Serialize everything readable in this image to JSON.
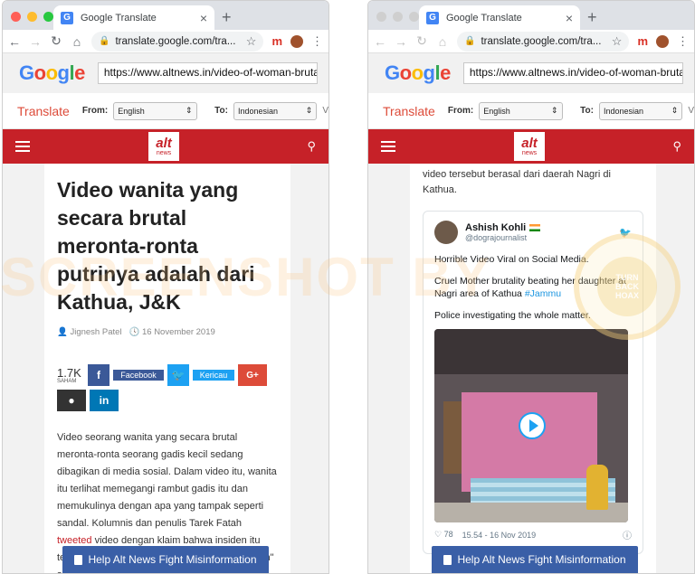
{
  "browser": {
    "tab_title": "Google Translate",
    "tab_close": "×",
    "new_tab": "+",
    "address": "translate.google.com/tra...",
    "menu_ext": "m"
  },
  "translate_bar": {
    "logo_letters": [
      "G",
      "o",
      "o",
      "g",
      "l",
      "e"
    ],
    "source_url_left": "https://www.altnews.in/video-of-woman-brutally-",
    "source_url_right": "https://www.altnews.in/video-of-woman-brutally-t",
    "translate_label": "Translate",
    "from_label": "From:",
    "from_value": "English",
    "to_label": "To:",
    "to_value": "Indonesian",
    "truncated": "V"
  },
  "site": {
    "logo_text": "alt",
    "logo_sub": "news"
  },
  "left_article": {
    "headline": "Video wanita yang secara brutal meronta-ronta putrinya adalah dari Kathua, J&K",
    "author": "Jignesh Patel",
    "date": "16 November 2019",
    "share_count": "1.7K",
    "share_label": "SAHAM",
    "facebook_label": "Facebook",
    "twitter_label": "Kericau",
    "gplus_label": "G+",
    "body_before_link": "Video seorang wanita yang secara brutal meronta-ronta seorang gadis kecil sedang dibagikan di media sosial. Dalam video itu, wanita itu terlihat memegangi rambut gadis itu dan memukulinya dengan apa yang tampak seperti sandal. Kolumnis dan penulis Tarek Fatah ",
    "body_link": "tweeted",
    "body_after_link": " video dengan klaim bahwa insiden itu terjadi di Pakistan dan bahwa \"pemukulan parah\" se..."
  },
  "right_article": {
    "continued_text": "video tersebut berasal dari daerah Nagri di Kathua.",
    "tweet": {
      "name": "Ashish Kohli",
      "handle": "@dograjournalist",
      "line1": "Horrible Video Viral on Social Media.",
      "line2": "Cruel Mother brutality beating her daughter at Nagri area of Kathua ",
      "hashtag": "#Jammu",
      "line3": "Police investigating the whole matter.",
      "likes": "78",
      "timestamp": "15.54 - 16 Nov 2019"
    }
  },
  "help_banner": "Help Alt News Fight Misinformation",
  "watermark_text": "SCREENSHOT BY",
  "seal_text": [
    "TURN",
    "BACK",
    "HOAX"
  ],
  "colors": {
    "brand_red": "#c62128",
    "translate_red": "#dd4b39",
    "help_blue": "#3a5fa7",
    "twitter_blue": "#1da1f2"
  }
}
